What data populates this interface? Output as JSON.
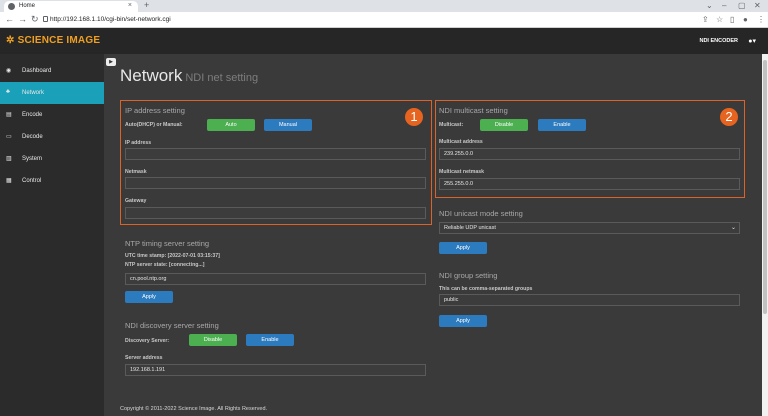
{
  "browser": {
    "tab_title": "Home",
    "tab_close": "×",
    "new_tab": "+",
    "url": "http://192.168.1.10/cgi-bin/set-network.cgi"
  },
  "header": {
    "brand": "SCIENCE IMAGE",
    "product": "NDI ENCODER"
  },
  "sidebar": {
    "items": [
      {
        "label": "Dashboard",
        "icon": "dashboard-icon"
      },
      {
        "label": "Network",
        "icon": "network-icon"
      },
      {
        "label": "Encode",
        "icon": "encode-icon"
      },
      {
        "label": "Decode",
        "icon": "decode-icon"
      },
      {
        "label": "System",
        "icon": "system-icon"
      },
      {
        "label": "Control",
        "icon": "control-icon"
      }
    ],
    "active": "Network"
  },
  "page": {
    "title": "Network",
    "subtitle": "NDI net setting"
  },
  "ip": {
    "title": "IP address setting",
    "mode_label": "Auto(DHCP) or Manual:",
    "auto": "Auto",
    "manual": "Manual",
    "ip_label": "IP address",
    "ip_value": "",
    "netmask_label": "Netmask",
    "netmask_value": "",
    "gateway_label": "Gateway",
    "gateway_value": "",
    "badge": "1"
  },
  "ntp": {
    "title": "NTP timing server setting",
    "utc": "UTC time stamp: [2022-07-01 03:15:37]",
    "state": "NTP server state: [connecting...]",
    "server": "cn.pool.ntp.org",
    "apply": "Apply"
  },
  "discovery": {
    "title": "NDI discovery server setting",
    "label": "Discovery Server:",
    "disable": "Disable",
    "enable": "Enable",
    "address_label": "Server address",
    "address": "192.168.1.191"
  },
  "multicast": {
    "title": "NDI multicast setting",
    "label": "Multicast:",
    "disable": "Disable",
    "enable": "Enable",
    "address_label": "Multicast address",
    "address": "239.255.0.0",
    "netmask_label": "Multicast netmask",
    "netmask": "255.255.0.0",
    "badge": "2"
  },
  "unicast": {
    "title": "NDI unicast mode setting",
    "selected": "Reliable UDP unicast",
    "apply": "Apply"
  },
  "group": {
    "title": "NDI group setting",
    "hint": "This can be comma-separated groups",
    "value": "public",
    "apply": "Apply"
  },
  "footer": {
    "copyright": "Copyright © 2011-2022 Science Image. All Rights Reserved."
  },
  "colors": {
    "accent": "#1aa0b8",
    "brand": "#f0a020",
    "green": "#4caf50",
    "blue": "#2d7bbf",
    "highlight": "#e6641f"
  }
}
